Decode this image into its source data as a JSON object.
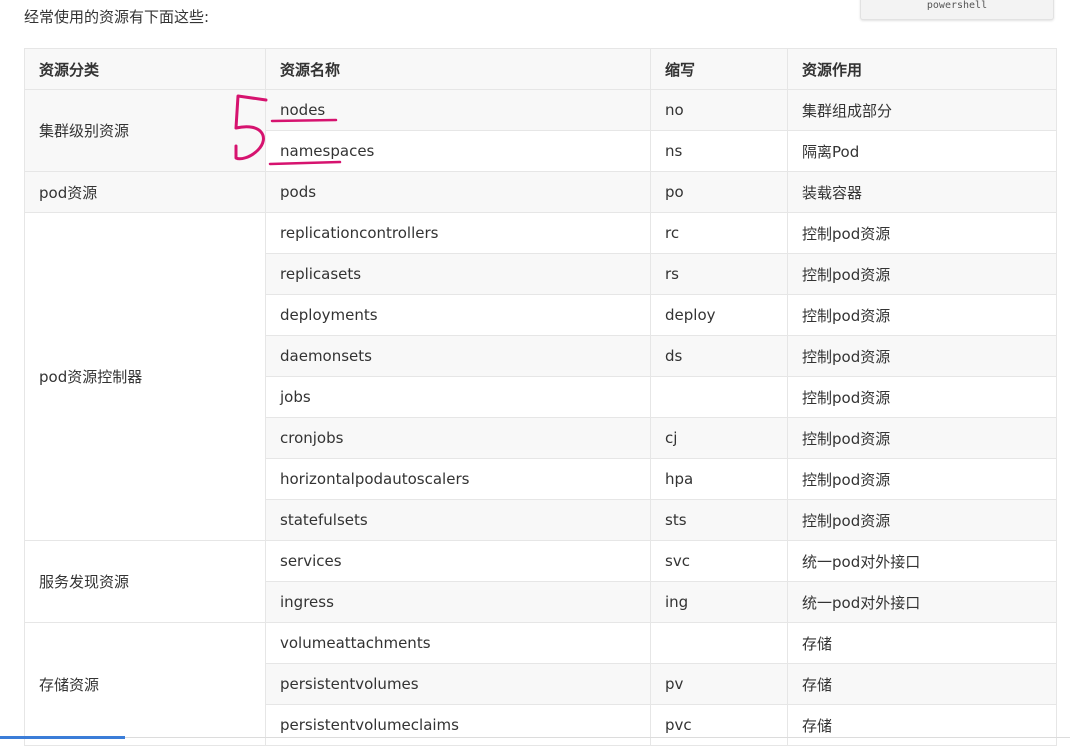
{
  "intro": "经常使用的资源有下面这些:",
  "code_tag": "powershell",
  "headers": [
    "资源分类",
    "资源名称",
    "缩写",
    "资源作用"
  ],
  "groups": [
    {
      "category": "集群级别资源",
      "rows": [
        {
          "name": "nodes",
          "short": "no",
          "purpose": "集群组成部分"
        },
        {
          "name": "namespaces",
          "short": "ns",
          "purpose": "隔离Pod"
        }
      ]
    },
    {
      "category": "pod资源",
      "rows": [
        {
          "name": "pods",
          "short": "po",
          "purpose": "装载容器"
        }
      ]
    },
    {
      "category": "pod资源控制器",
      "rows": [
        {
          "name": "replicationcontrollers",
          "short": "rc",
          "purpose": "控制pod资源"
        },
        {
          "name": "replicasets",
          "short": "rs",
          "purpose": "控制pod资源"
        },
        {
          "name": "deployments",
          "short": "deploy",
          "purpose": "控制pod资源"
        },
        {
          "name": "daemonsets",
          "short": "ds",
          "purpose": "控制pod资源"
        },
        {
          "name": "jobs",
          "short": "",
          "purpose": "控制pod资源"
        },
        {
          "name": "cronjobs",
          "short": "cj",
          "purpose": "控制pod资源"
        },
        {
          "name": "horizontalpodautoscalers",
          "short": "hpa",
          "purpose": "控制pod资源"
        },
        {
          "name": "statefulsets",
          "short": "sts",
          "purpose": "控制pod资源"
        }
      ]
    },
    {
      "category": "服务发现资源",
      "rows": [
        {
          "name": "services",
          "short": "svc",
          "purpose": "统一pod对外接口"
        },
        {
          "name": "ingress",
          "short": "ing",
          "purpose": "统一pod对外接口"
        }
      ]
    },
    {
      "category": "存储资源",
      "rows": [
        {
          "name": "volumeattachments",
          "short": "",
          "purpose": "存储"
        },
        {
          "name": "persistentvolumes",
          "short": "pv",
          "purpose": "存储"
        },
        {
          "name": "persistentvolumeclaims",
          "short": "pvc",
          "purpose": "存储"
        }
      ]
    }
  ],
  "annotation_color": "#d6136f",
  "accent_color": "#3b7dd8"
}
